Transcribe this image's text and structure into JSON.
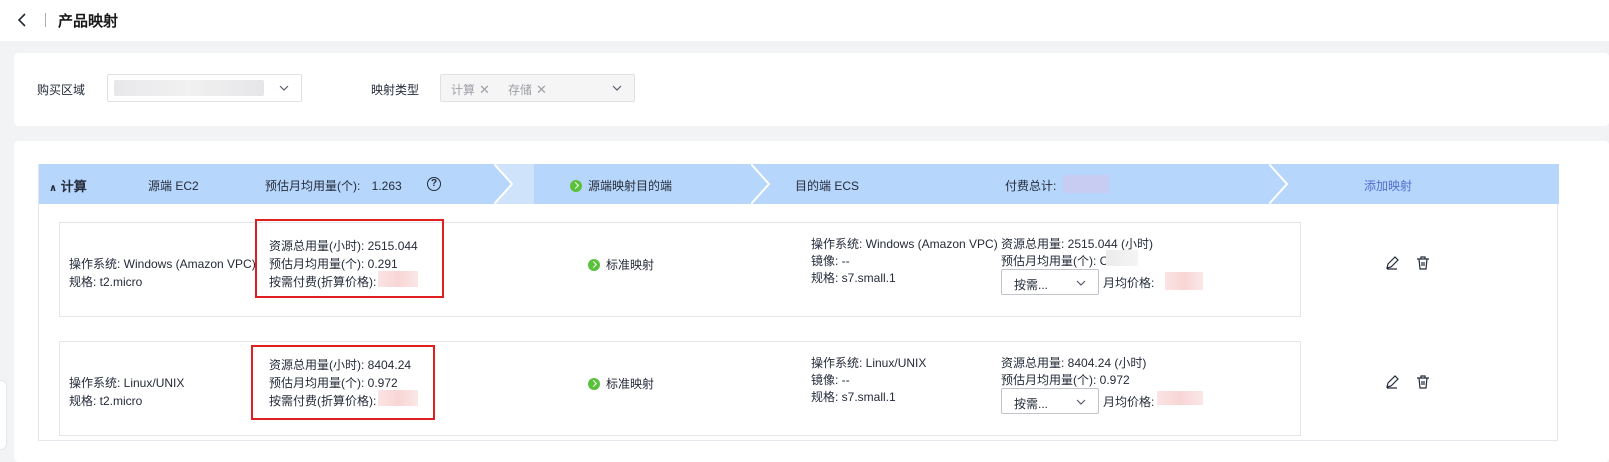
{
  "header": {
    "title": "产品映射"
  },
  "filters": {
    "region_label": "购买区域",
    "type_label": "映射类型",
    "type_tags": [
      "计算",
      "存储"
    ]
  },
  "group": {
    "title": "计算",
    "source_label": "源端 EC2",
    "monthly_usage_label": "预估月均用量(个):",
    "monthly_usage_value": "1.263",
    "mapping_step": "源端映射目的端",
    "target_label": "目的端 ECS",
    "total_label": "付费总计:",
    "add_mapping": "添加映射"
  },
  "rows": [
    {
      "src_os": "操作系统:  Windows (Amazon VPC)",
      "src_spec": "规格:  t2.micro",
      "usage_total": "资源总用量(小时):  2515.044",
      "usage_monthly": "预估月均用量(个):  0.291",
      "ondemand": "按需付费(折算价格):",
      "mapping": "标准映射",
      "dst_os": "操作系统:  Windows (Amazon VPC)",
      "dst_image": "镜像:  --",
      "dst_spec": "规格:  s7.small.1",
      "dst_usage_total": "资源总用量:  2515.044 (小时)",
      "dst_usage_monthly": "预估月均用量(个):  C",
      "billing_select": "按需...",
      "monthly_price": "月均价格:"
    },
    {
      "src_os": "操作系统:  Linux/UNIX",
      "src_spec": "规格:  t2.micro",
      "usage_total": "资源总用量(小时):  8404.24",
      "usage_monthly": "预估月均用量(个):  0.972",
      "ondemand": "按需付费(折算价格):",
      "mapping": "标准映射",
      "dst_os": "操作系统:  Linux/UNIX",
      "dst_image": "镜像:  --",
      "dst_spec": "规格:  s7.small.1",
      "dst_usage_total": "资源总用量:  8404.24 (小时)",
      "dst_usage_monthly": "预估月均用量(个):  0.972",
      "billing_select": "按需...",
      "monthly_price": "月均价格:"
    }
  ]
}
